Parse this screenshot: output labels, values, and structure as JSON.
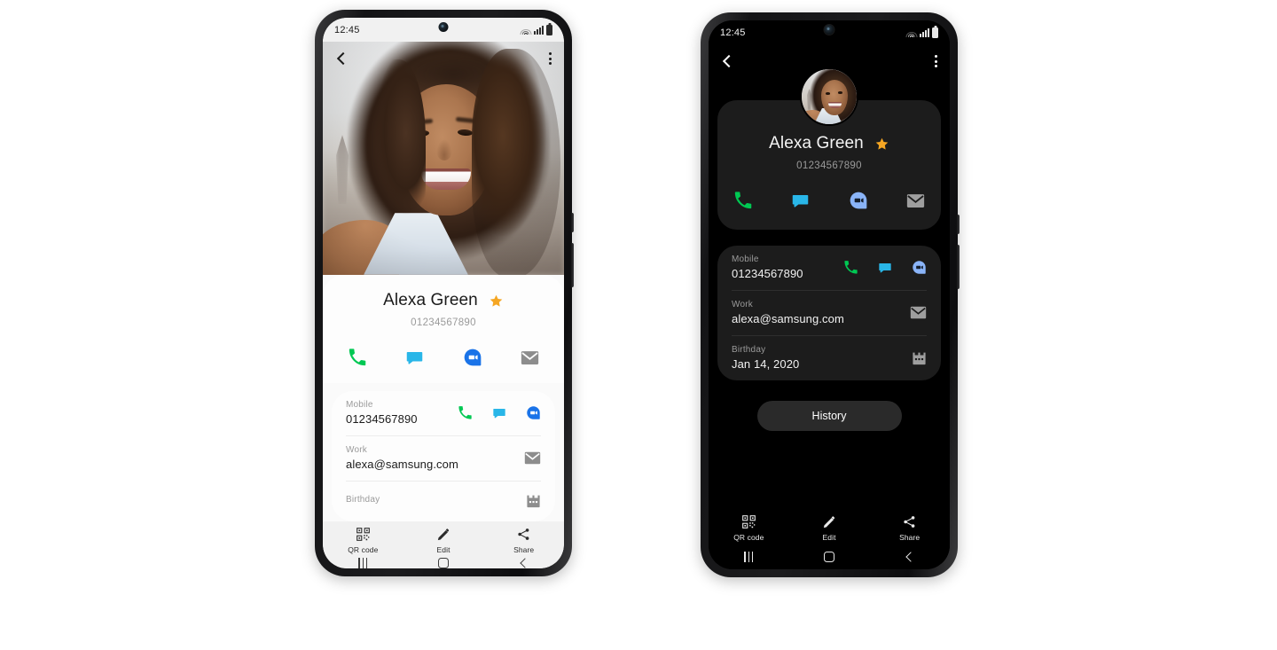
{
  "page": {
    "background": "#ffffff",
    "description": "Samsung contacts app — contact detail screen shown in light mode (left phone) and dark mode (right phone)"
  },
  "status_bar": {
    "time": "12:45",
    "icons": [
      "wifi-icon",
      "signal-icon",
      "battery-icon"
    ]
  },
  "app_bar": {
    "back": "back-icon",
    "more": "more-options-icon"
  },
  "contact": {
    "name": "Alexa Green",
    "favorite": true,
    "favorite_icon": "star-icon",
    "phone_display": "01234567890",
    "quick_actions": [
      {
        "name": "call-action",
        "icon": "phone-icon",
        "color": "#00c853"
      },
      {
        "name": "message-action",
        "icon": "message-icon",
        "color": "#29b6e8"
      },
      {
        "name": "video-call-action",
        "icon": "duo-video-icon",
        "color": "#1a73e8"
      },
      {
        "name": "email-action",
        "icon": "email-icon",
        "color": "#8d8d8d"
      }
    ],
    "details": [
      {
        "label": "Mobile",
        "value": "01234567890",
        "icons": [
          {
            "name": "phone-icon",
            "color": "#00c853"
          },
          {
            "name": "message-icon",
            "color": "#29b6e8"
          },
          {
            "name": "duo-video-icon",
            "color": "#1a73e8"
          }
        ]
      },
      {
        "label": "Work",
        "value": "alexa@samsung.com",
        "icons": [
          {
            "name": "email-icon",
            "color": "#8d8d8d"
          }
        ]
      },
      {
        "label": "Birthday",
        "value": "Jan 14, 2020",
        "icons": [
          {
            "name": "calendar-icon",
            "color": "#8d8d8d"
          }
        ]
      }
    ],
    "history_button": "History"
  },
  "bottom_bar": {
    "items": [
      {
        "label": "QR code",
        "icon": "qr-code-icon"
      },
      {
        "label": "Edit",
        "icon": "pencil-icon"
      },
      {
        "label": "Share",
        "icon": "share-icon"
      }
    ]
  },
  "nav_bar": {
    "items": [
      {
        "name": "recents-button",
        "icon": "recents-icon"
      },
      {
        "name": "home-button",
        "icon": "home-icon"
      },
      {
        "name": "back-button",
        "icon": "back-icon"
      }
    ]
  },
  "colors": {
    "light_screen_bg": "#fafafa",
    "light_card_bg": "#fdfdfd",
    "dark_screen_bg": "#000000",
    "dark_card_bg": "#1c1c1c",
    "star": "#f5a623",
    "phone_green": "#00c853",
    "message_blue": "#29b6e8",
    "duo_blue": "#1a73e8",
    "duo_blue_dark": "#8ab4f8",
    "email_gray": "#8d8d8d",
    "history_btn_bg": "#2a2a2a"
  }
}
